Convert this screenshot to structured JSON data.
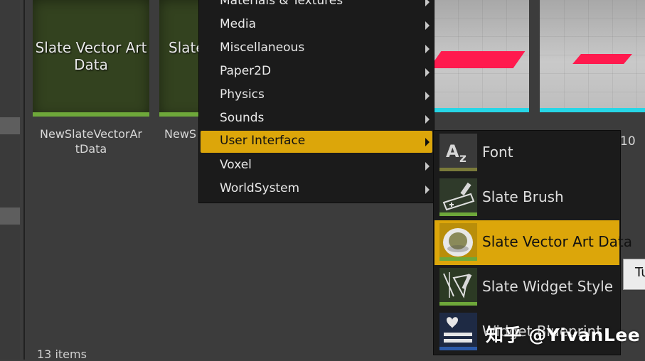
{
  "assets": [
    {
      "thumb_text": "Slate Vector Art Data",
      "label": "NewSlateVectorArtData"
    },
    {
      "thumb_text": "Slate",
      "label": "NewS"
    }
  ],
  "right_partial_label": "10",
  "items_count": "13 items",
  "menu": {
    "items": [
      {
        "label": "Materials & Textures",
        "has_submenu": true
      },
      {
        "label": "Media",
        "has_submenu": true
      },
      {
        "label": "Miscellaneous",
        "has_submenu": true
      },
      {
        "label": "Paper2D",
        "has_submenu": true
      },
      {
        "label": "Physics",
        "has_submenu": true
      },
      {
        "label": "Sounds",
        "has_submenu": true
      },
      {
        "label": "User Interface",
        "has_submenu": true,
        "active": true
      },
      {
        "label": "Voxel",
        "has_submenu": true
      },
      {
        "label": "WorldSystem",
        "has_submenu": true
      }
    ]
  },
  "submenu": {
    "items": [
      {
        "label": "Font",
        "icon": "font-icon",
        "accent": "#7a7a3a"
      },
      {
        "label": "Slate Brush",
        "icon": "slate-brush-icon",
        "accent": "#6ea83a"
      },
      {
        "label": "Slate Vector Art Data",
        "icon": "ring-icon",
        "accent": "#6ea83a",
        "active": true
      },
      {
        "label": "Slate Widget Style",
        "icon": "widget-style-icon",
        "accent": "#6ea83a"
      },
      {
        "label": "Widget Blueprint",
        "icon": "widget-blueprint-icon",
        "accent": "#2c5aa8"
      }
    ]
  },
  "tooltip": {
    "text": "Tu"
  },
  "watermark": "知乎 @YivanLee",
  "colors": {
    "highlight": "#dca60a",
    "menu_bg": "#1b1b1b",
    "asset_bar": "#6ea83a",
    "texture_bar": "#27d6e6"
  }
}
